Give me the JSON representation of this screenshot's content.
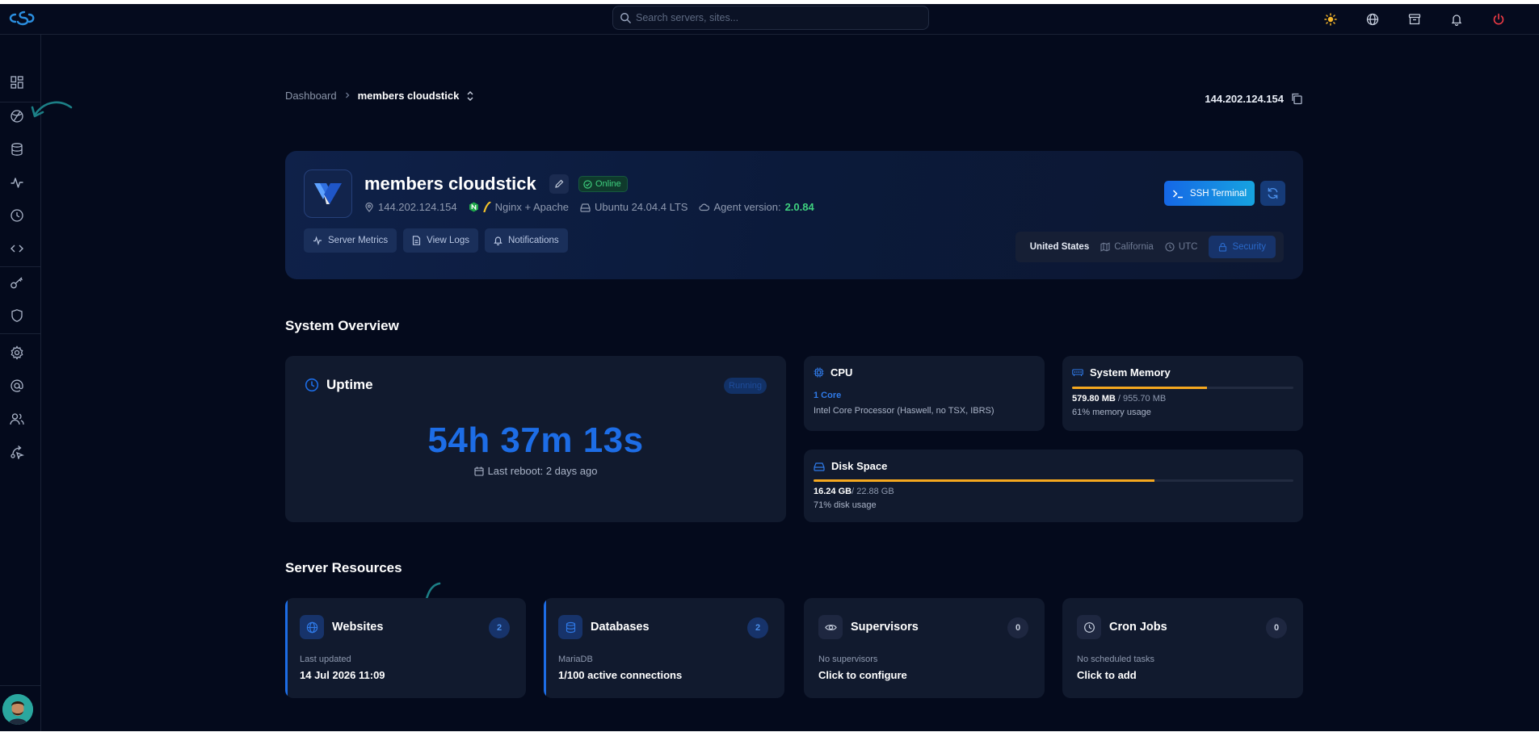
{
  "topbar": {
    "search_placeholder": "Search servers, sites..."
  },
  "breadcrumb": {
    "home": "Dashboard",
    "current": "members cloudstick"
  },
  "header_ip": "144.202.124.154",
  "server": {
    "name": "members cloudstick",
    "status": "Online",
    "ip": "144.202.124.154",
    "web_server": "Nginx + Apache",
    "os": "Ubuntu 24.04.4 LTS",
    "agent_label": "Agent version:",
    "agent_version": "2.0.84",
    "buttons": {
      "metrics": "Server Metrics",
      "logs": "View Logs",
      "notifications": "Notifications",
      "ssh": "SSH Terminal"
    },
    "location": {
      "country": "United States",
      "region": "California",
      "timezone": "UTC",
      "security": "Security"
    }
  },
  "overview": {
    "title": "System Overview",
    "uptime": {
      "label": "Uptime",
      "status": "Running",
      "value": "54h 37m 13s",
      "last_reboot": "Last reboot: 2 days ago"
    },
    "cpu": {
      "label": "CPU",
      "cores": "1 Core",
      "model": "Intel Core Processor (Haswell, no TSX, IBRS)"
    },
    "memory": {
      "label": "System Memory",
      "used": "579.80 MB",
      "total": "/ 955.70 MB",
      "usage_text": "61% memory usage",
      "percent": 61
    },
    "disk": {
      "label": "Disk Space",
      "used": "16.24 GB",
      "total": "/ 22.88 GB",
      "usage_text": "71% disk usage",
      "percent": 71
    }
  },
  "resources": {
    "title": "Server Resources",
    "items": [
      {
        "title": "Websites",
        "count": "2",
        "sub": "Last updated",
        "value": "14 Jul 2026 11:09"
      },
      {
        "title": "Databases",
        "count": "2",
        "sub": "MariaDB",
        "value": "1/100 active connections"
      },
      {
        "title": "Supervisors",
        "count": "0",
        "sub": "No supervisors",
        "value": "Click to configure"
      },
      {
        "title": "Cron Jobs",
        "count": "0",
        "sub": "No scheduled tasks",
        "value": "Click to add"
      }
    ]
  },
  "colors": {
    "background": "#040a1c",
    "accent": "#1d6de6",
    "online": "#3fd17f",
    "usage_bar": "#f5a81f",
    "annotation_arrow": "#1c7f86"
  },
  "icons": {
    "sidebar": [
      "dashboard-icon",
      "servers-icon",
      "database-icon",
      "activity-icon",
      "clock-icon",
      "code-icon",
      "key-icon",
      "shield-icon",
      "settings-icon",
      "at-icon",
      "users-icon",
      "deploy-icon"
    ],
    "topbar": [
      "sun-icon",
      "globe-icon",
      "archive-icon",
      "bell-icon",
      "power-icon"
    ]
  }
}
